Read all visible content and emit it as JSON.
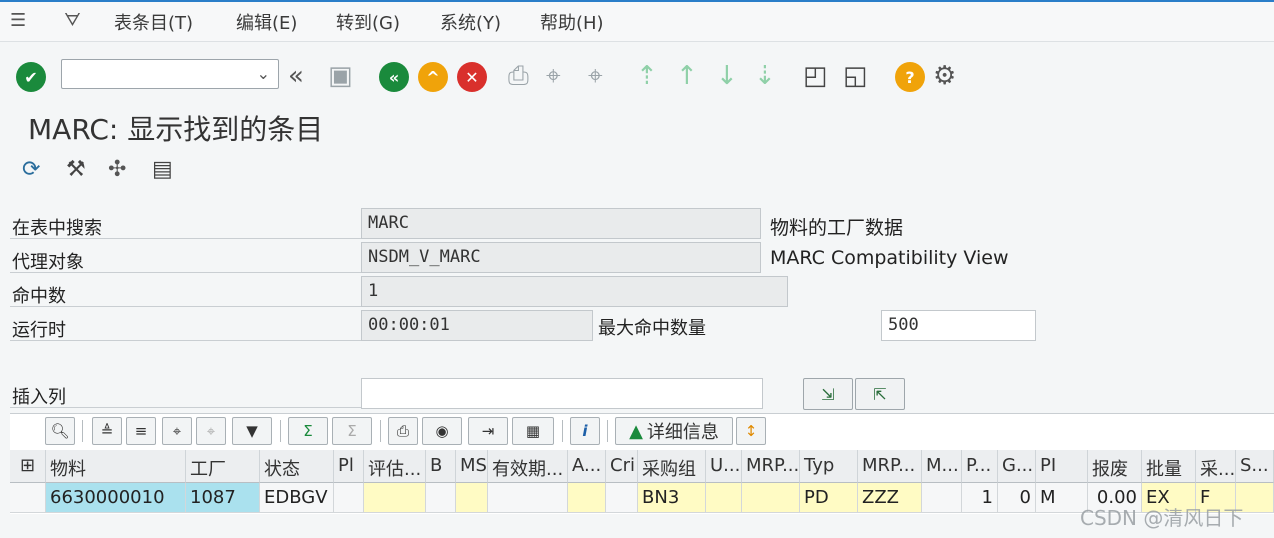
{
  "menu": {
    "items": [
      "表条目(T)",
      "编辑(E)",
      "转到(G)",
      "系统(Y)",
      "帮助(H)"
    ]
  },
  "toolbar": {
    "icons": [
      "check-icon",
      "back-double-icon",
      "save-icon",
      "back-icon",
      "exit-icon",
      "cancel-icon",
      "print-icon",
      "find-icon",
      "find-next-icon",
      "first-page-icon",
      "prev-page-icon",
      "next-page-icon",
      "last-page-icon",
      "new-session-icon",
      "shortcut-icon",
      "help-icon",
      "settings-icon"
    ],
    "colors": {
      "green": "#1a8a3c",
      "orange": "#f0a30a",
      "red": "#d9302c"
    }
  },
  "page": {
    "title": "MARC: 显示找到的条目"
  },
  "form": {
    "search_table_label": "在表中搜索",
    "search_table_value": "MARC",
    "search_table_desc": "物料的工厂数据",
    "proxy_label": "代理对象",
    "proxy_value": "NSDM_V_MARC",
    "proxy_desc": "MARC Compatibility View",
    "hits_label": "命中数",
    "hits_value": "1",
    "runtime_label": "运行时",
    "runtime_value": "00:00:01",
    "max_hits_label": "最大命中数量",
    "max_hits_value": "500",
    "insert_col_label": "插入列",
    "insert_col_value": ""
  },
  "alv": {
    "detail_label": "详细信息"
  },
  "grid": {
    "headers": [
      "物料",
      "工厂",
      "状态",
      "Pl",
      "评估...",
      "B",
      "MS",
      "有效期...",
      "A...",
      "Cri",
      "采购组",
      "U...",
      "MRP...",
      "Typ",
      "MRP...",
      "M...",
      "P...",
      "G...",
      "PI",
      "报废",
      "批量",
      "采...",
      "S..."
    ],
    "row": [
      "6630000010",
      "1087",
      "EDBGV",
      "",
      "",
      "",
      "",
      "",
      "",
      "",
      "BN3",
      "",
      "",
      "PD",
      "ZZZ",
      "",
      "1",
      "0",
      "M",
      "0.00",
      "EX",
      "F",
      ""
    ]
  },
  "watermark": "CSDN @清风日下"
}
